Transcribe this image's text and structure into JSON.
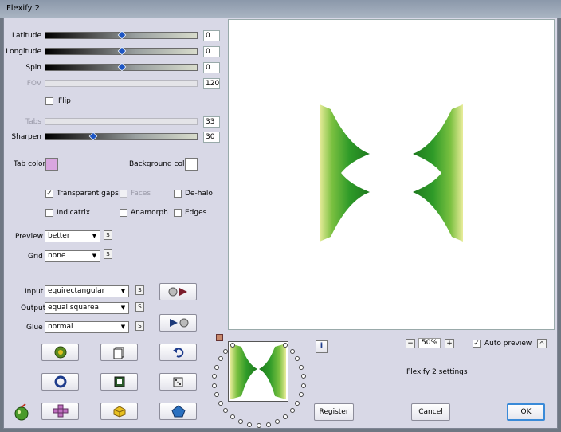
{
  "window": {
    "title": "Flexify 2"
  },
  "sliders": [
    {
      "label": "Latitude",
      "value": "0",
      "level": 0.5,
      "enabled": true
    },
    {
      "label": "Longitude",
      "value": "0",
      "level": 0.5,
      "enabled": true
    },
    {
      "label": "Spin",
      "value": "0",
      "level": 0.5,
      "enabled": true
    },
    {
      "label": "FOV",
      "value": "120",
      "level": 0.0,
      "enabled": false
    },
    {
      "label": "Tabs",
      "value": "33",
      "level": 0.0,
      "enabled": false
    },
    {
      "label": "Sharpen",
      "value": "30",
      "level": 0.3,
      "enabled": true
    }
  ],
  "flip": {
    "label": "Flip",
    "checked": false
  },
  "colors": {
    "tab_color_label": "Tab color",
    "tab_color": "#d9a6e0",
    "background_color_label": "Background color",
    "background_color": "#ffffff"
  },
  "options": {
    "transparent_gaps": {
      "label": "Transparent gaps",
      "checked": true
    },
    "faces": {
      "label": "Faces",
      "checked": false
    },
    "de_halo": {
      "label": "De-halo",
      "checked": false
    },
    "indicatrix": {
      "label": "Indicatrix",
      "checked": false
    },
    "anamorph": {
      "label": "Anamorph",
      "checked": false
    },
    "edges": {
      "label": "Edges",
      "checked": false
    }
  },
  "preview_quality": {
    "label": "Preview",
    "value": "better"
  },
  "grid": {
    "label": "Grid",
    "value": "none"
  },
  "projection": {
    "input": {
      "label": "Input",
      "value": "equirectangular"
    },
    "output": {
      "label": "Output",
      "value": "equal squarea"
    },
    "glue": {
      "label": "Glue",
      "value": "normal"
    }
  },
  "save_button_glyph": "S",
  "zoom": {
    "minus": "−",
    "value": "50%",
    "plus": "+"
  },
  "auto_preview": {
    "label": "Auto preview",
    "checked": true,
    "toggle": "^"
  },
  "settings_label": "Flexify 2 settings",
  "info_glyph": "i",
  "buttons": {
    "register": "Register",
    "cancel": "Cancel",
    "ok": "OK"
  },
  "accent": "#2a8a26"
}
